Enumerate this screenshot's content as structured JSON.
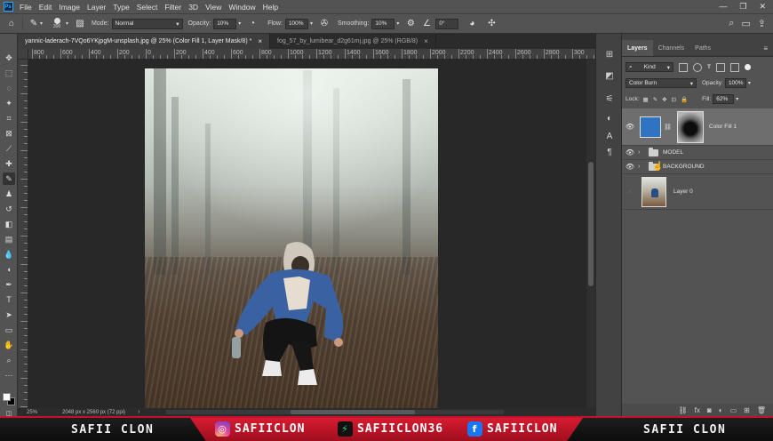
{
  "menubar": {
    "items": [
      "File",
      "Edit",
      "Image",
      "Layer",
      "Type",
      "Select",
      "Filter",
      "3D",
      "View",
      "Window",
      "Help"
    ],
    "window_controls": [
      "—",
      "❐",
      "✕"
    ]
  },
  "options": {
    "brush_size": "300",
    "mode_label": "Mode:",
    "mode_value": "Normal",
    "opacity_label": "Opacity:",
    "opacity_value": "10%",
    "flow_label": "Flow:",
    "flow_value": "100%",
    "smoothing_label": "Smoothing:",
    "smoothing_value": "10%",
    "angle_value": "0°"
  },
  "tabs": [
    {
      "label": "yannic-laderach-7VQo6YKjpgM-unsplash.jpg @ 25% (Color Fill 1, Layer Mask/8) *",
      "close": "×"
    },
    {
      "label": "fog_57_by_lumibear_d2g61mj.jpg @ 25% (RGB/8)",
      "close": "×"
    }
  ],
  "ruler": {
    "ticks": [
      "800",
      "600",
      "400",
      "200",
      "0",
      "200",
      "400",
      "600",
      "800",
      "1000",
      "1200",
      "1400",
      "1600",
      "1800",
      "2000",
      "2200",
      "2400",
      "2600",
      "2800",
      "300"
    ]
  },
  "status": {
    "zoom": "25%",
    "doc_info": "2048 px x 2560 px (72 ppi)",
    "arrow": "›"
  },
  "layers_panel": {
    "tabs": [
      "Layers",
      "Channels",
      "Paths"
    ],
    "kind_label": "Kind",
    "blend_mode": "Color Burn",
    "opacity_label": "Opacity:",
    "opacity_value": "100%",
    "lock_label": "Lock:",
    "fill_label": "Fill:",
    "fill_value": "62%",
    "layers": [
      {
        "name": "Color Fill 1",
        "type": "fill"
      },
      {
        "name": "MODEL",
        "type": "group"
      },
      {
        "name": "BACKGROUND",
        "type": "group"
      },
      {
        "name": "Layer 0",
        "type": "pixel"
      }
    ],
    "footer_icons": [
      "link-icon",
      "fx-icon",
      "mask-icon",
      "adjustment-icon",
      "folder-icon",
      "new-layer-icon",
      "trash-icon"
    ]
  },
  "banner": {
    "left": "SAFII CLON",
    "instagram": "SAFIICLON",
    "patreon": "SAFIICLON36",
    "facebook": "SAFIICLON",
    "right": "SAFII CLON"
  },
  "colors": {
    "accent": "#31a8ff",
    "banner_red": "#c8102e",
    "fill_layer": "#2f74c0"
  }
}
